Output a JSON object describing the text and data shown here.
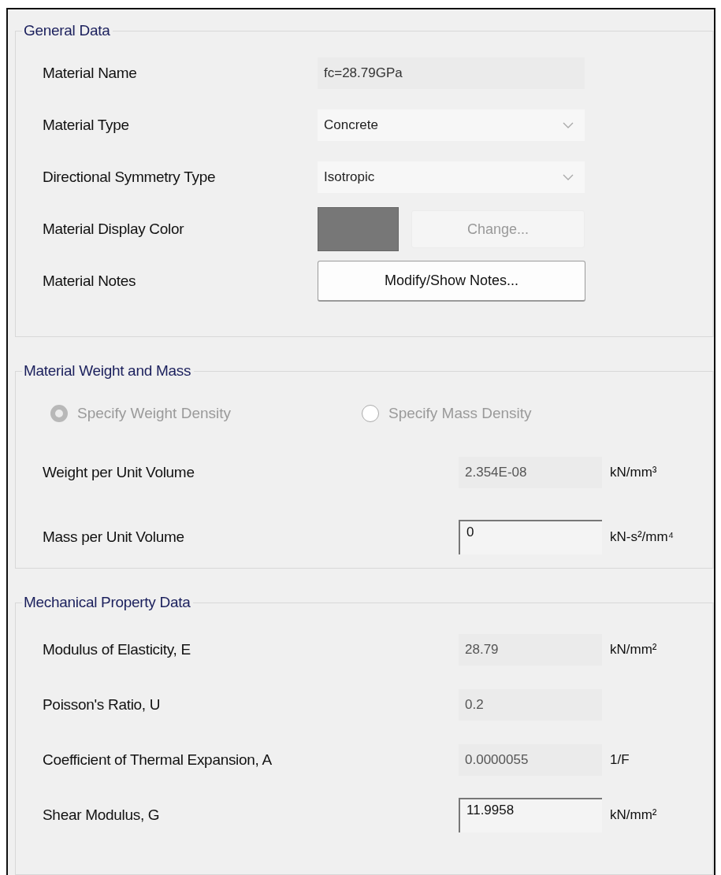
{
  "general": {
    "title": "General Data",
    "rows": [
      {
        "kind": "text",
        "label": "Material Name",
        "value": "fc=28.79GPa"
      },
      {
        "kind": "dropdown",
        "label": "Material Type",
        "value": "Concrete"
      },
      {
        "kind": "dropdown",
        "label": "Directional Symmetry Type",
        "value": "Isotropic"
      },
      {
        "kind": "color",
        "label": "Material Display Color",
        "color": "#777777",
        "button": {
          "label": "Change...",
          "disabled": true
        }
      },
      {
        "kind": "button",
        "label": "Material Notes",
        "button": {
          "label": "Modify/Show Notes...",
          "disabled": false
        }
      }
    ]
  },
  "weight": {
    "title": "Material Weight and Mass",
    "radios": [
      {
        "label": "Specify Weight Density",
        "selected": true,
        "disabled": true
      },
      {
        "label": "Specify Mass Density",
        "selected": false,
        "disabled": true
      }
    ],
    "rows": [
      {
        "label": "Weight per Unit Volume",
        "value": "2.354E-08",
        "unit": "kN/mm³",
        "editable": false
      },
      {
        "label": "Mass per Unit Volume",
        "value": "0",
        "unit": "kN-s²/mm⁴",
        "editable": true
      }
    ]
  },
  "mechanical": {
    "title": "Mechanical Property Data",
    "rows": [
      {
        "label": "Modulus of Elasticity, E",
        "value": "28.79",
        "unit": "kN/mm²",
        "editable": false
      },
      {
        "label": "Poisson's Ratio, U",
        "value": "0.2",
        "editable": false
      },
      {
        "label": "Coefficient of Thermal Expansion, A",
        "value": "0.0000055",
        "unit": "1/F",
        "editable": false
      },
      {
        "label": "Shear Modulus, G",
        "value": "11.9958",
        "unit": "kN/mm²",
        "editable": true
      }
    ]
  }
}
